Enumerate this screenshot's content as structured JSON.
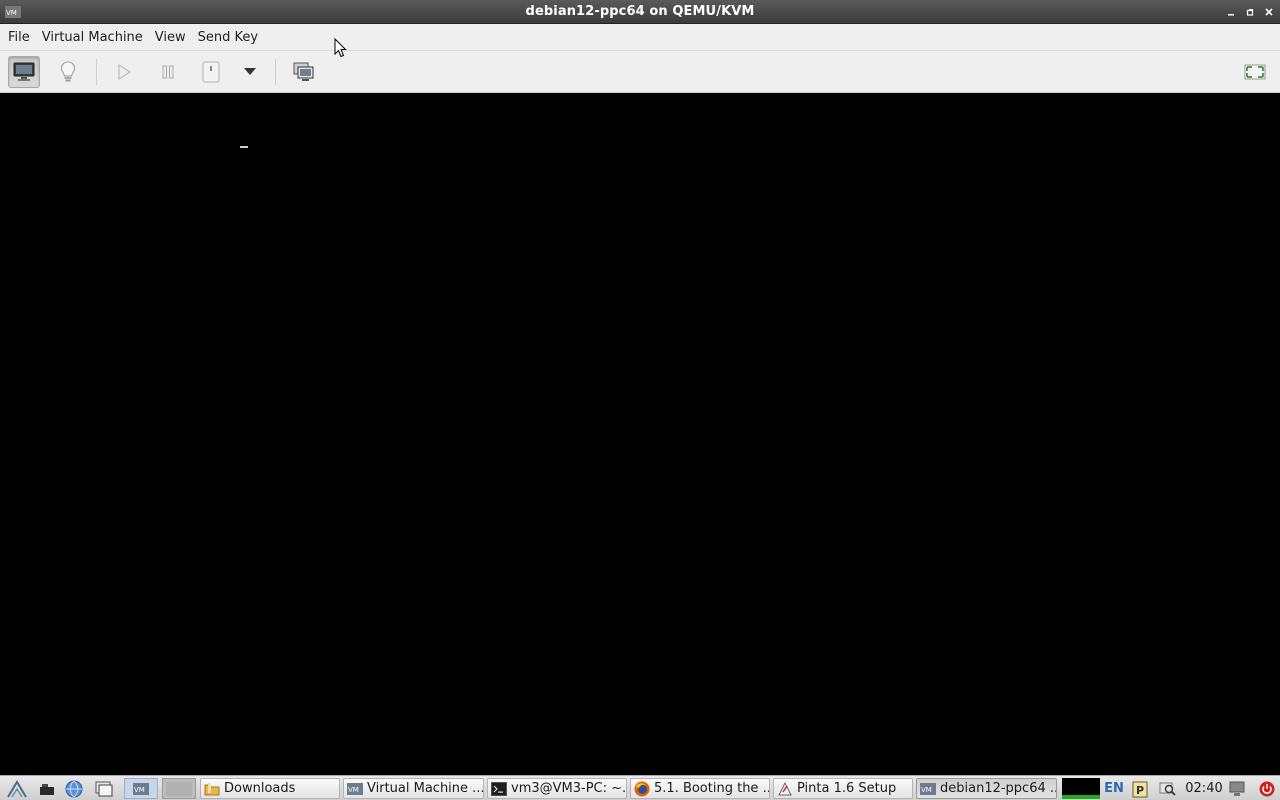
{
  "window": {
    "title": "debian12-ppc64 on QEMU/KVM"
  },
  "menubar": {
    "items": [
      "File",
      "Virtual Machine",
      "View",
      "Send Key"
    ]
  },
  "toolbar": {
    "buttons": [
      {
        "name": "console-view-icon",
        "active": true
      },
      {
        "name": "details-lightbulb-icon",
        "active": false
      },
      {
        "name": "run-icon",
        "active": false
      },
      {
        "name": "pause-icon",
        "active": false
      },
      {
        "name": "shutdown-icon",
        "active": false
      },
      {
        "name": "shutdown-menu-chevron-icon",
        "active": false
      },
      {
        "name": "snapshots-icon",
        "active": false
      },
      {
        "name": "fullscreen-icon",
        "active": false
      }
    ]
  },
  "taskbar": {
    "tasks": [
      {
        "label": "Downloads",
        "icon": "folder-icon"
      },
      {
        "label": "Virtual Machine ...",
        "icon": "virt-manager-icon"
      },
      {
        "label": "vm3@VM3-PC: ~...",
        "icon": "terminal-icon"
      },
      {
        "label": "5.1. Booting the ...",
        "icon": "firefox-icon"
      },
      {
        "label": "Pinta 1.6 Setup",
        "icon": "pinta-icon"
      },
      {
        "label": "debian12-ppc64 ...",
        "icon": "virt-manager-icon",
        "active": true
      }
    ],
    "keyboard_layout": "EN",
    "clock": "02:40",
    "colors": {
      "keyboard_layout": "#2a6bb0",
      "power": "#cc2222",
      "cpu_graph": "#22aa22"
    }
  }
}
